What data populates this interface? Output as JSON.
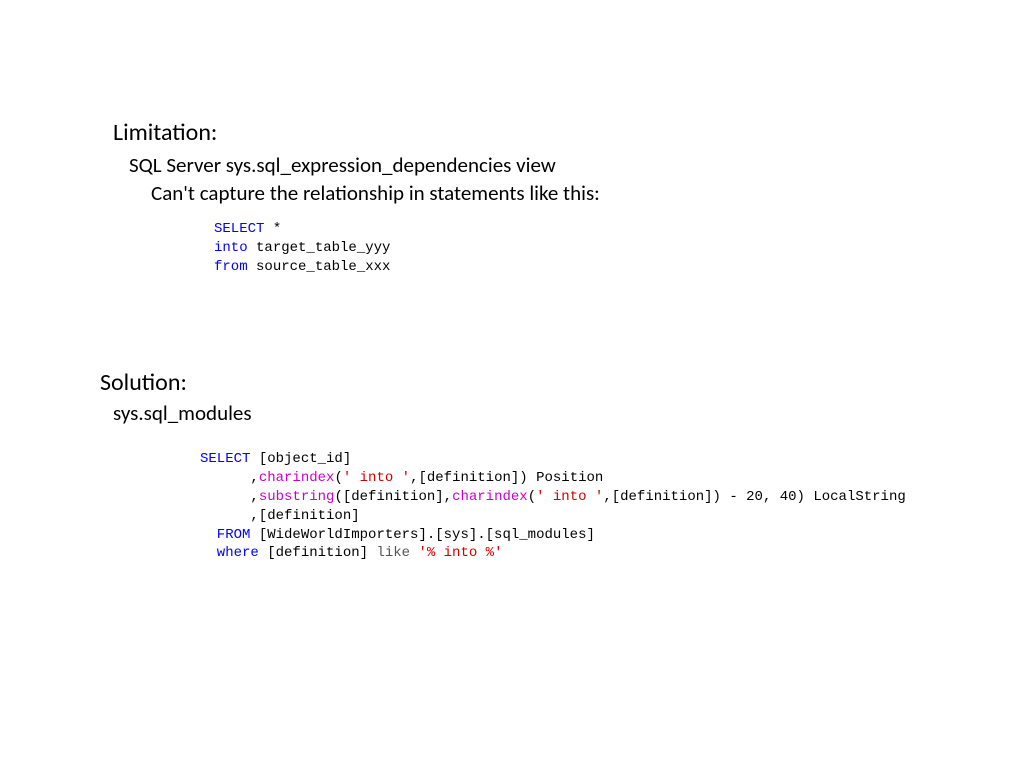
{
  "limitation": {
    "heading": "Limitation:",
    "line1": "SQL Server sys.sql_expression_dependencies view",
    "line2": "Can't capture the relationship in statements like this:",
    "code": {
      "l1a": "SELECT",
      "l1b": " *",
      "l2a": "into",
      "l2b": " target_table_yyy",
      "l3a": "from",
      "l3b": " source_table_xxx"
    }
  },
  "solution": {
    "heading": "Solution:",
    "line1": "sys.sql_modules",
    "code": {
      "l1a": "SELECT",
      "l1b": " [object_id]",
      "l2a": "      ,",
      "l2b": "charindex",
      "l2c": "(",
      "l2d": "' into '",
      "l2e": ",[definition]) Position",
      "l3a": "      ,",
      "l3b": "substring",
      "l3c": "([definition],",
      "l3d": "charindex",
      "l3e": "(",
      "l3f": "' into '",
      "l3g": ",[definition]) - 20, 40) LocalString",
      "l4": "      ,[definition]",
      "l5a": "  FROM",
      "l5b": " [WideWorldImporters].[sys].[sql_modules]",
      "l6a": "  where",
      "l6b": " [definition] ",
      "l6c": "like",
      "l6d": " ",
      "l6e": "'% into %'"
    }
  }
}
